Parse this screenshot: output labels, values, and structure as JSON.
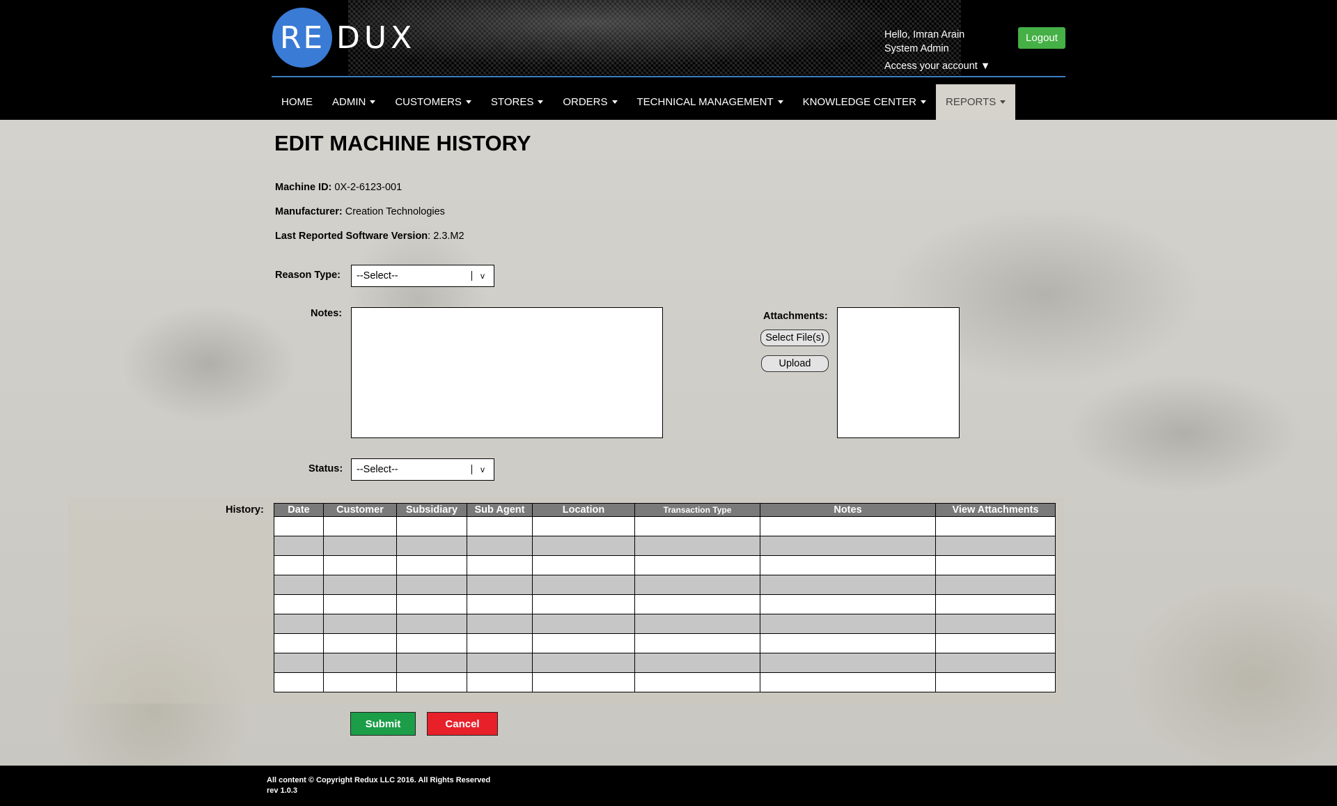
{
  "header": {
    "logo_left": "RE",
    "logo_right": "DUX",
    "greeting": "Hello, Imran Arain",
    "role": "System Admin",
    "account_link": "Access your account ▼",
    "logout_label": "Logout"
  },
  "nav": {
    "items": [
      {
        "label": "HOME",
        "caret": false
      },
      {
        "label": "ADMIN",
        "caret": true
      },
      {
        "label": "CUSTOMERS",
        "caret": true
      },
      {
        "label": "STORES",
        "caret": true
      },
      {
        "label": "ORDERS",
        "caret": true
      },
      {
        "label": "TECHNICAL MANAGEMENT",
        "caret": true
      },
      {
        "label": "KNOWLEDGE CENTER",
        "caret": true
      },
      {
        "label": "REPORTS",
        "caret": true,
        "active": true
      }
    ]
  },
  "page": {
    "title": "EDIT MACHINE HISTORY",
    "machine_id_label": "Machine ID:",
    "machine_id_value": " 0X-2-6123-001",
    "manufacturer_label": "Manufacturer:",
    "manufacturer_value": " Creation Technologies",
    "software_label": "Last Reported Software Version",
    "software_value": ": 2.3.M2"
  },
  "form": {
    "reason_type_label": "Reason Type:",
    "reason_type_value": "--Select--",
    "notes_label": "Notes:",
    "attachments_label": "Attachments:",
    "select_files_label": "Select File(s)",
    "upload_label": "Upload",
    "status_label": "Status:",
    "status_value": "--Select--",
    "select_arrow": "v"
  },
  "history": {
    "label": "History:",
    "columns": [
      "Date",
      "Customer",
      "Subsidiary",
      "Sub Agent",
      "Location",
      "Transaction Type",
      "Notes",
      "View Attachments"
    ],
    "row_count": 9
  },
  "actions": {
    "submit_label": "Submit",
    "cancel_label": "Cancel"
  },
  "footer": {
    "copyright": "All content © Copyright Redux LLC 2016. All Rights Reserved",
    "revision": "rev 1.0.3"
  },
  "colors": {
    "brand_blue": "#3a7bd5",
    "logout_green": "#45b045",
    "submit_green": "#1c9e49",
    "cancel_red": "#e8202a"
  }
}
